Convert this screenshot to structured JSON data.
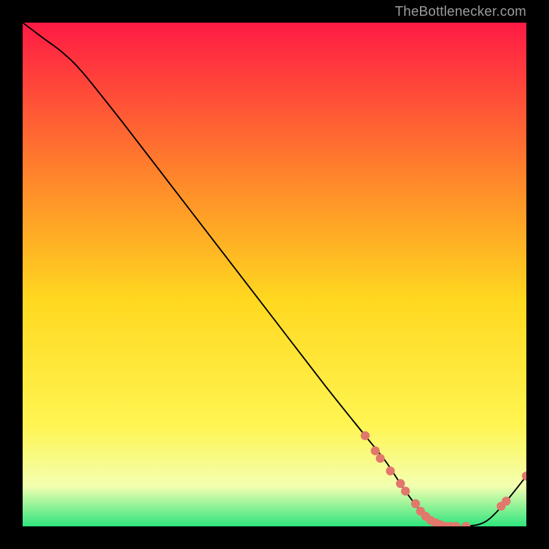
{
  "attribution": "TheBottlenecker.com",
  "colors": {
    "black": "#000000",
    "curve": "#000000",
    "marker": "#e2776c",
    "grad_top": "#ff1a44",
    "grad_mid_upper": "#ff8a2a",
    "grad_mid": "#ffd81f",
    "grad_mid_lower": "#fff552",
    "grad_low": "#f3ffb0",
    "grad_bottom": "#2fe57e"
  },
  "chart_data": {
    "type": "line",
    "title": "",
    "xlabel": "",
    "ylabel": "",
    "xlim": [
      0,
      100
    ],
    "ylim": [
      0,
      100
    ],
    "grid": false,
    "legend": false,
    "series": [
      {
        "name": "bottleneck-curve",
        "x": [
          0,
          4,
          8,
          12,
          20,
          30,
          40,
          50,
          60,
          68,
          72,
          76,
          80,
          84,
          88,
          92,
          96,
          100
        ],
        "y": [
          100,
          97,
          94,
          90,
          80,
          67,
          54,
          41,
          28,
          18,
          13,
          7,
          2,
          0,
          0,
          1,
          5,
          10
        ]
      }
    ],
    "valley_markers_x": [
      68,
      70,
      71,
      73,
      75,
      76,
      78,
      79,
      80,
      81,
      82,
      83,
      84,
      85,
      86,
      88,
      95,
      96,
      100
    ],
    "valley_markers_y": [
      18,
      15,
      13.5,
      11,
      8.5,
      7,
      4.5,
      3,
      2,
      1.2,
      0.7,
      0.3,
      0,
      0,
      0,
      0,
      4,
      5,
      10
    ]
  }
}
